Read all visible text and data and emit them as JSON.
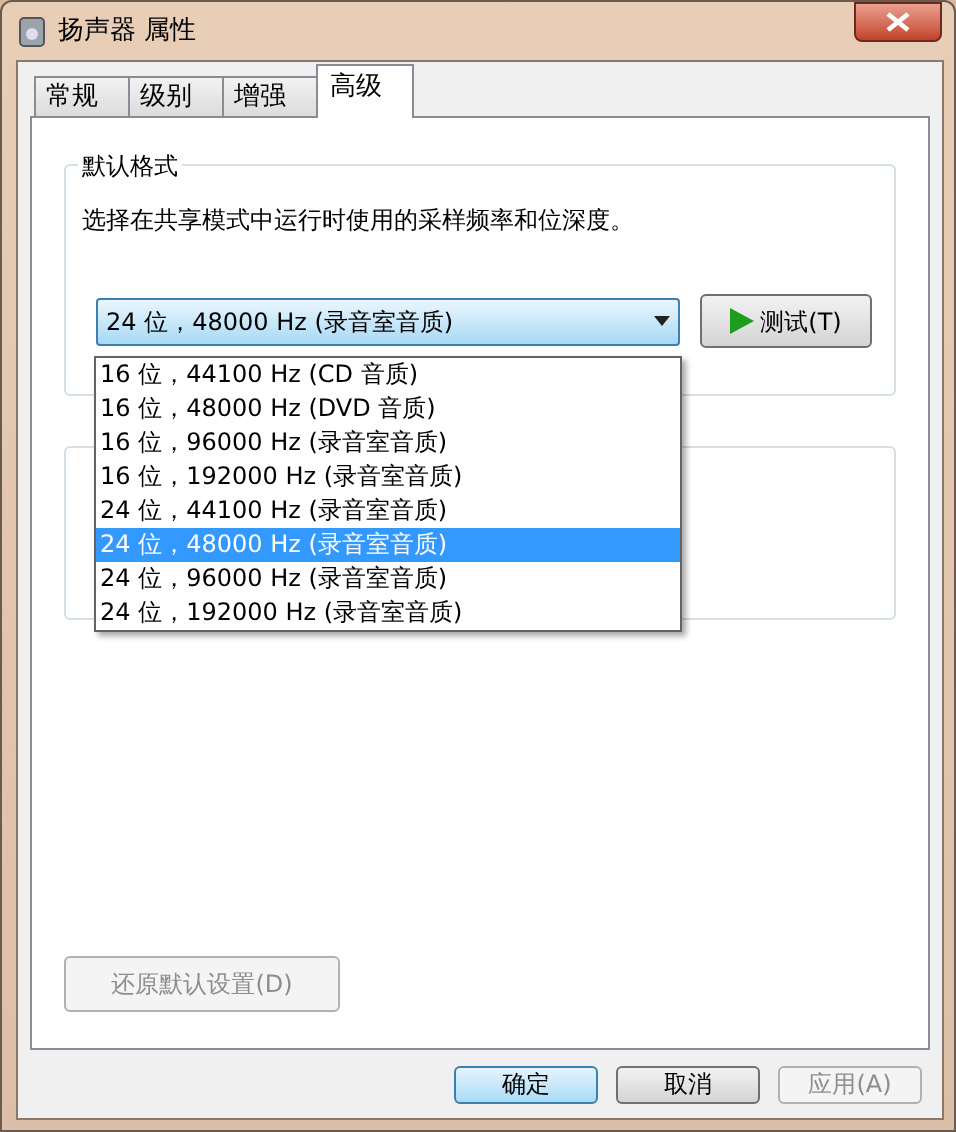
{
  "window": {
    "title": "扬声器 属性"
  },
  "tabs": [
    {
      "label": "常规",
      "selected": false
    },
    {
      "label": "级别",
      "selected": false
    },
    {
      "label": "增强",
      "selected": false
    },
    {
      "label": "高级",
      "selected": true
    }
  ],
  "default_format": {
    "title": "默认格式",
    "description": "选择在共享模式中运行时使用的采样频率和位深度。",
    "value": "24 位，48000 Hz (录音室音质)",
    "expanded": true,
    "options": [
      {
        "label": "16 位，44100 Hz (CD 音质)",
        "selected": false
      },
      {
        "label": "16 位，48000 Hz (DVD 音质)",
        "selected": false
      },
      {
        "label": "16 位，96000 Hz (录音室音质)",
        "selected": false
      },
      {
        "label": "16 位，192000 Hz (录音室音质)",
        "selected": false
      },
      {
        "label": "24 位，44100 Hz (录音室音质)",
        "selected": false
      },
      {
        "label": "24 位，48000 Hz (录音室音质)",
        "selected": true
      },
      {
        "label": "24 位，96000 Hz (录音室音质)",
        "selected": false
      },
      {
        "label": "24 位，192000 Hz (录音室音质)",
        "selected": false
      }
    ],
    "test_button": "测试(T)"
  },
  "restore_button": {
    "label": "还原默认设置(D)",
    "disabled": true
  },
  "buttons": [
    {
      "label": "确定",
      "kind": "default",
      "disabled": false
    },
    {
      "label": "取消",
      "kind": "normal",
      "disabled": false
    },
    {
      "label": "应用(A)",
      "kind": "normal",
      "disabled": true
    }
  ]
}
